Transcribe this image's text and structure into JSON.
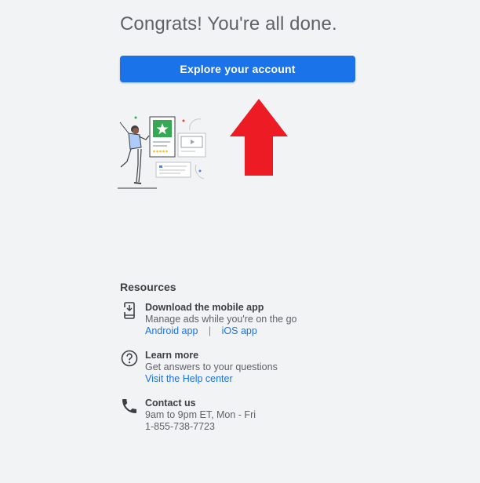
{
  "headline": "Congrats! You're all done.",
  "explore_button": "Explore your account",
  "illustration": {
    "name": "celebration-illustration",
    "accent_colors": [
      "#34a853",
      "#fbbc04",
      "#ea4335",
      "#4285f4"
    ]
  },
  "annotation_arrow": {
    "color": "#ed1c24",
    "direction": "up"
  },
  "resources": {
    "title": "Resources",
    "items": [
      {
        "icon": "phone-download-icon",
        "title": "Download the mobile app",
        "desc": "Manage ads while you're on the go",
        "links": [
          "Android app",
          "iOS app"
        ],
        "separator": "|"
      },
      {
        "icon": "help-circle-icon",
        "title": "Learn more",
        "desc": "Get answers to your questions",
        "links": [
          "Visit the Help center"
        ]
      },
      {
        "icon": "phone-icon",
        "title": "Contact us",
        "desc": "9am to 9pm ET, Mon - Fri",
        "desc2": "1-855-738-7723"
      }
    ]
  },
  "colors": {
    "background": "#f1f3f4",
    "primary": "#1a73e8",
    "text": "#3c4043",
    "secondary_text": "#5f6368"
  }
}
